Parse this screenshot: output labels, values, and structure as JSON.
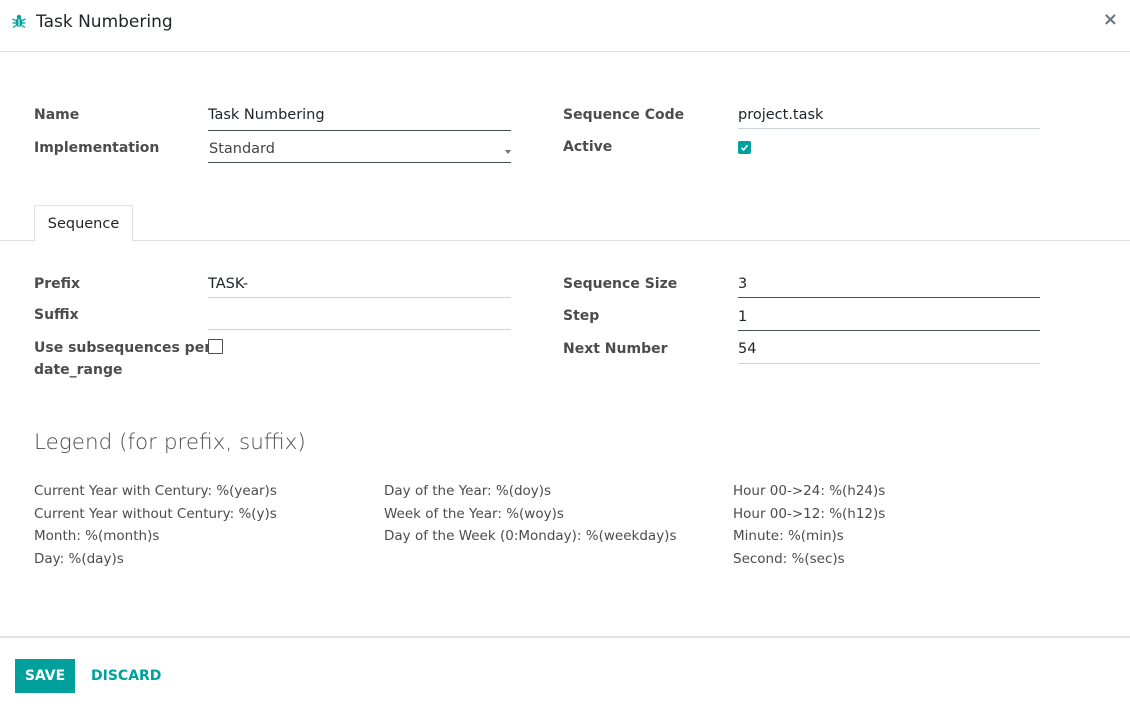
{
  "dialog": {
    "title": "Task Numbering",
    "close_label": "×"
  },
  "form": {
    "name_label": "Name",
    "name_value": "Task Numbering",
    "implementation_label": "Implementation",
    "implementation_value": "Standard",
    "sequence_code_label": "Sequence Code",
    "sequence_code_value": "project.task",
    "active_label": "Active",
    "active_checked": true
  },
  "tabs": [
    {
      "label": "Sequence",
      "active": true
    }
  ],
  "sequence": {
    "prefix_label": "Prefix",
    "prefix_value": "TASK-",
    "suffix_label": "Suffix",
    "suffix_value": "",
    "subseq_label_line1": "Use subsequences per",
    "subseq_label_line2": "date_range",
    "subseq_checked": false,
    "size_label": "Sequence Size",
    "size_value": "3",
    "step_label": "Step",
    "step_value": "1",
    "next_label": "Next Number",
    "next_value": "54"
  },
  "legend": {
    "title": "Legend (for prefix, suffix)",
    "col1": [
      "Current Year with Century: %(year)s",
      "Current Year without Century: %(y)s",
      "Month: %(month)s",
      "Day: %(day)s"
    ],
    "col2": [
      "Day of the Year: %(doy)s",
      "Week of the Year: %(woy)s",
      "Day of the Week (0:Monday): %(weekday)s"
    ],
    "col3": [
      "Hour 00->24: %(h24)s",
      "Hour 00->12: %(h12)s",
      "Minute: %(min)s",
      "Second: %(sec)s"
    ]
  },
  "footer": {
    "save_label": "SAVE",
    "discard_label": "DISCARD"
  },
  "colors": {
    "accent": "#00A09D",
    "icon": "#00A09D"
  },
  "icons": {
    "title_icon": "bug-icon",
    "close": "close-icon",
    "dropdown": "caret-down-icon",
    "checkbox": "check-icon"
  }
}
